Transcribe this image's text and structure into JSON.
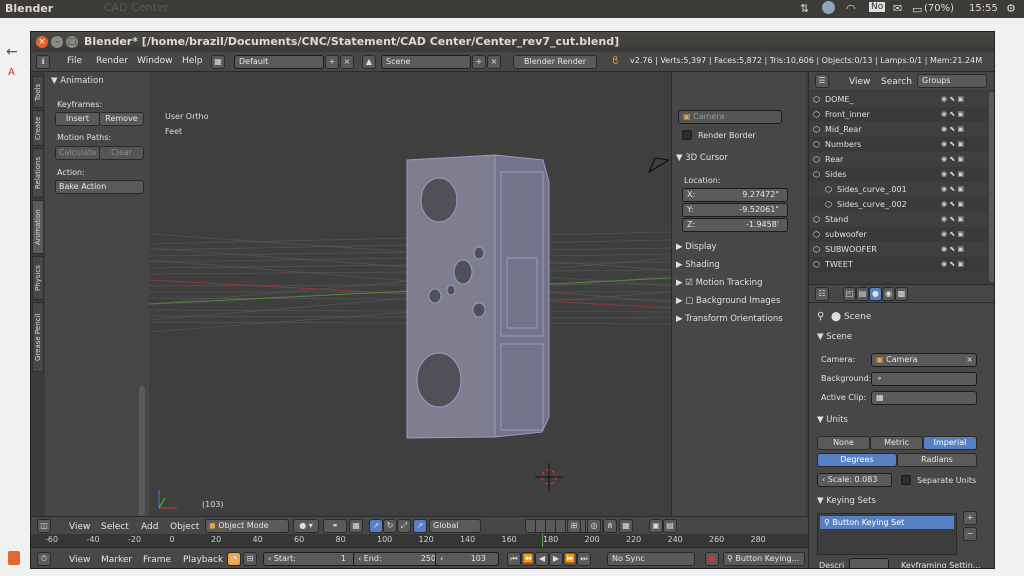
{
  "system": {
    "app_name": "Blender",
    "tray_input": "No",
    "battery": "(70%)",
    "time": "15:55",
    "ghost_tab": "CAD Center"
  },
  "window": {
    "title": "Blender* [/home/brazil/Documents/CNC/Statement/CAD Center/Center_rev7_cut.blend]"
  },
  "menu": {
    "items": [
      "File",
      "Render",
      "Window",
      "Help"
    ],
    "layout": "Default",
    "scene": "Scene",
    "engine": "Blender Render",
    "stats": "v2.76 | Verts:5,397 | Faces:5,872 | Tris:10,606 | Objects:0/13 | Lamps:0/1 | Mem:21.24M"
  },
  "tools": {
    "tabs": [
      "Tools",
      "Create",
      "Relations",
      "Animation",
      "Physics",
      "Grease Pencil"
    ],
    "header": "Animation",
    "keyframes_label": "Keyframes:",
    "insert": "Insert",
    "remove": "Remove",
    "motion_paths_label": "Motion Paths:",
    "calculate": "Calculate",
    "clear": "Clear",
    "action_label": "Action:",
    "bake_action": "Bake Action"
  },
  "viewport": {
    "view_name": "User Ortho",
    "units": "Feet",
    "frame": "(103)"
  },
  "npanel": {
    "camera_field": "Camera",
    "render_border": "Render Border",
    "cursor_header": "3D Cursor",
    "location_label": "Location:",
    "x": "X:",
    "x_val": "9.27472\"",
    "y": "Y:",
    "y_val": "-9.52061\"",
    "z": "Z:",
    "z_val": "-1.9458'",
    "display": "Display",
    "shading": "Shading",
    "motion_tracking": "Motion Tracking",
    "background_images": "Background Images",
    "transform_orientations": "Transform Orientations"
  },
  "outliner": {
    "tabs": [
      "View",
      "Search",
      "Groups"
    ],
    "rows": [
      "DOME_",
      "Front_inner",
      "Mid_Rear",
      "Numbers",
      "Rear",
      "Sides",
      "Sides_curve_.001",
      "Sides_curve_.002",
      "Stand",
      "subwoofer",
      "SUBWOOFER",
      "TWEET"
    ]
  },
  "props": {
    "scene": "Scene",
    "scene_panel": "Scene",
    "camera_label": "Camera:",
    "camera_val": "Camera",
    "background_label": "Background:",
    "active_clip_label": "Active Clip:",
    "units_panel": "Units",
    "none": "None",
    "metric": "Metric",
    "imperial": "Imperial",
    "degrees": "Degrees",
    "radians": "Radians",
    "scale_label": "Scale:",
    "scale_val": "0.083",
    "separate_units": "Separate Units",
    "keying_panel": "Keying Sets",
    "keying_item": "Button Keying Set",
    "descr_label": "Descri",
    "keyframing_settings": "Keyframing Settin..."
  },
  "view_header": {
    "items": [
      "View",
      "Select",
      "Add",
      "Object"
    ],
    "mode": "Object Mode",
    "orientation": "Global"
  },
  "ruler": {
    "ticks": [
      "-60",
      "-40",
      "-20",
      "0",
      "20",
      "40",
      "60",
      "80",
      "100",
      "120",
      "140",
      "160",
      "180",
      "200",
      "220",
      "240",
      "260",
      "280"
    ]
  },
  "timeline": {
    "items": [
      "View",
      "Marker",
      "Frame",
      "Playback"
    ],
    "start_label": "Start:",
    "start": "1",
    "end_label": "End:",
    "end": "250",
    "current": "103",
    "sync": "No Sync",
    "keying": "Button Keying..."
  }
}
